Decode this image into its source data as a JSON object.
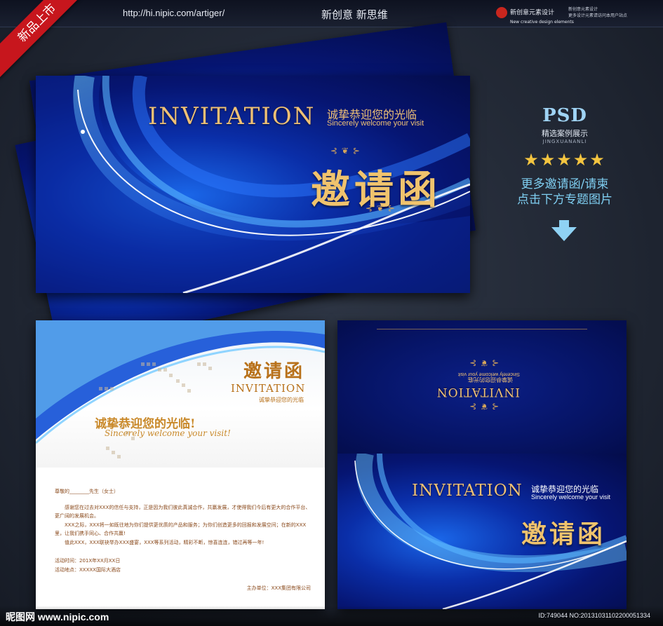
{
  "topbar": {
    "url": "http://hi.nipic.com/artiger/",
    "slogan": "新创意  新思维",
    "brand_name": "新创意元素设计",
    "brand_en": "New creative design elements",
    "brand_line1": "新创意元素设计",
    "brand_line2": "更多设计元素请访问本用户站点"
  },
  "ribbon": "新品上市",
  "main_card": {
    "title_en": "INVITATION",
    "welcome_cn": "诚挚恭迎您的光临",
    "welcome_en": "Sincerely welcome your visit",
    "title_cn": "邀请函"
  },
  "side_panel": {
    "psd": "PSD",
    "sub": "精选案例展示",
    "sub_en": "JINGXUANANLI",
    "stars": "★★★★★",
    "more_line1": "更多邀请函/请柬",
    "more_line2": "点击下方专题图片"
  },
  "letter": {
    "title_cn": "邀请函",
    "title_en": "INVITATION",
    "welcome_small": "诚挚恭迎您的光临",
    "welcome_big": "诚挚恭迎您的光临!",
    "welcome_script": "Sincerely welcome your visit!",
    "greeting": "尊敬的________先生（女士）",
    "para1": "感谢您在过去对XXX的信任与支持，正是因为我们彼此真诚合作，共赢发展，才使得我们今后有更大的合作平台、更广阔的发展机会。",
    "para2": "XXX之际，XXX将一如既往地为你们提供更优质的产品和服务；为你们创造更多的回报和发展空间；在新的XXX里，让我们携手同心、合作共赢!",
    "para3": "值此XXX，XXX联袂举办XXX盛宴，XXX等系列活动，精彩不断，惊喜连连，错过再等一年!",
    "time": "活动时间：201X年XX月XX日",
    "place": "活动地点：XXXXX国际大酒店",
    "host": "主办单位：XXX集团有限公司"
  },
  "inside_card": {
    "title_en": "INVITATION",
    "welcome_cn": "诚挚恭迎您的光临",
    "welcome_en": "Sincerely welcome your visit",
    "title_cn": "邀请函",
    "flipped_title_en": "INVITATION",
    "flipped_welcome_cn": "诚挚恭迎您的光临",
    "flipped_welcome_en": "Sincerely welcome your visit"
  },
  "watermark": {
    "site": "昵图网 www.nipic.com",
    "id": "ID:749044 NO:20131031102200051334"
  },
  "colors": {
    "background": "#232a36",
    "ribbon": "#c7161d",
    "gold": "#efc075",
    "deep_blue": "#061572",
    "bright_blue": "#1a66e8",
    "side_accent": "#7fcff2",
    "star": "#f4c540"
  }
}
